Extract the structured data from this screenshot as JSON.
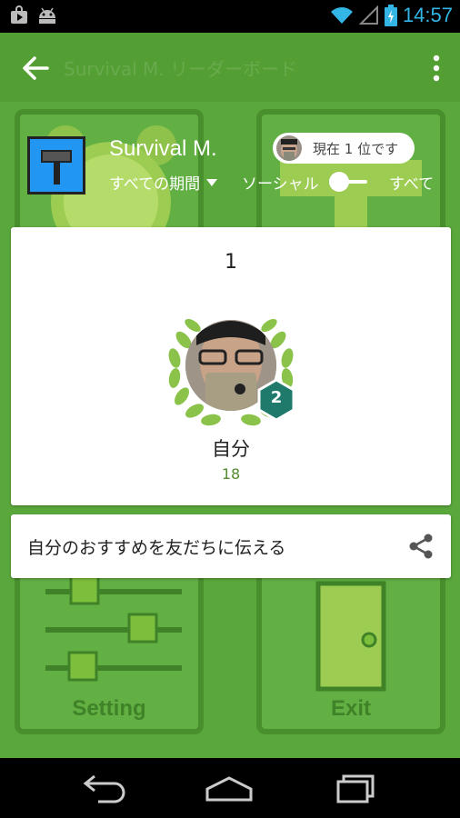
{
  "status": {
    "time": "14:57"
  },
  "action_bar": {
    "title": "Survival M. リーダーボード"
  },
  "game": {
    "title": "Survival M.",
    "rank_badge": "現在 1 位です",
    "period": "すべての期間",
    "social_label": "ソーシャル",
    "all_label": "すべて"
  },
  "leaderboard": {
    "rank": "1",
    "level": "2",
    "player_name": "自分",
    "score": "18"
  },
  "share": {
    "label": "自分のおすすめを友だちに伝える"
  },
  "background_tiles": {
    "setting": "Setting",
    "exit": "Exit"
  },
  "colors": {
    "accent": "#5aa83c",
    "score": "#558b2f",
    "level_badge": "#1f7a6b",
    "status_time": "#33b5e5"
  }
}
